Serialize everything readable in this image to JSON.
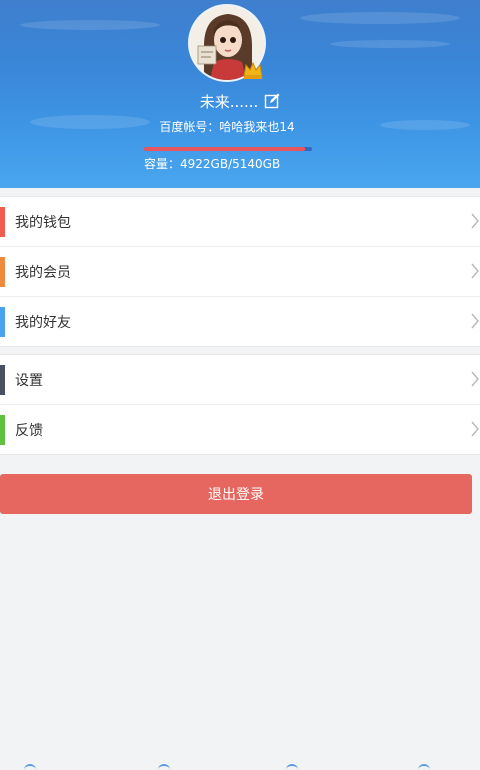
{
  "profile": {
    "username": "未来......",
    "account_label": "百度帐号：",
    "account_value": "哈哈我来也14",
    "capacity_label": "容量：",
    "capacity_value": "4922GB/5140GB",
    "usage_fraction": 0.9576
  },
  "menu": {
    "group1": [
      {
        "label": "我的钱包",
        "color": "#ef5b4f"
      },
      {
        "label": "我的会员",
        "color": "#f08a3c"
      },
      {
        "label": "我的好友",
        "color": "#4aa3ef"
      }
    ],
    "group2": [
      {
        "label": "设置",
        "color": "#4a5061"
      },
      {
        "label": "反馈",
        "color": "#5fc13e"
      }
    ]
  },
  "logout_label": "退出登录",
  "colors": {
    "header": "#3f8ad9",
    "logout": "#e56760",
    "progress_fill": "#e5575c"
  },
  "icons": {
    "edit": "edit-icon",
    "chevron": "chevron-right-icon",
    "badge": "crown-badge-icon"
  }
}
